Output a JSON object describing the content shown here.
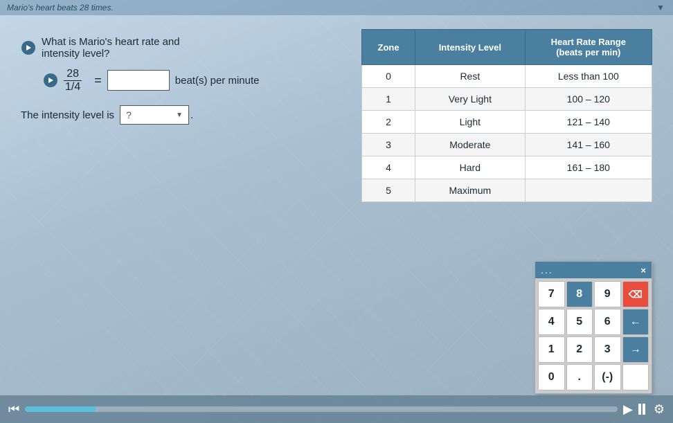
{
  "topBar": {
    "text": "Mario's heart beats 28 times.",
    "chevronLabel": "▲"
  },
  "question": {
    "audioIconLabel": "audio",
    "text1": "What is Mario's heart rate and",
    "text2": "intensity level?",
    "fraction": {
      "numerator": "28",
      "denominator": "1/4"
    },
    "equalsSign": "=",
    "answerPlaceholder": "",
    "bpmLabel": "beat(s) per minute"
  },
  "intensityRow": {
    "label": "The intensity level is",
    "dropdownValue": "?",
    "period": "."
  },
  "table": {
    "headers": [
      "Zone",
      "Intensity Level",
      "Heart Rate Range\n(beats per min)"
    ],
    "rows": [
      {
        "zone": "0",
        "intensity": "Rest",
        "range": "Less than 100"
      },
      {
        "zone": "1",
        "intensity": "Very Light",
        "range": "100 – 120"
      },
      {
        "zone": "2",
        "intensity": "Light",
        "range": "121 – 140"
      },
      {
        "zone": "3",
        "intensity": "Moderate",
        "range": "141 – 160"
      },
      {
        "zone": "4",
        "intensity": "Hard",
        "range": "161 – 180"
      },
      {
        "zone": "5",
        "intensity": "Maximum",
        "range": ""
      }
    ]
  },
  "keypad": {
    "dotsLabel": "...",
    "closeLabel": "×",
    "keys": [
      {
        "value": "7",
        "type": "normal"
      },
      {
        "value": "8",
        "type": "blue"
      },
      {
        "value": "9",
        "type": "normal"
      },
      {
        "value": "⌫",
        "type": "backspace"
      },
      {
        "value": "4",
        "type": "normal"
      },
      {
        "value": "5",
        "type": "normal"
      },
      {
        "value": "6",
        "type": "normal"
      },
      {
        "value": "←",
        "type": "blue"
      },
      {
        "value": "1",
        "type": "normal"
      },
      {
        "value": "2",
        "type": "normal"
      },
      {
        "value": "3",
        "type": "normal"
      },
      {
        "value": "→",
        "type": "blue"
      },
      {
        "value": "0",
        "type": "normal"
      },
      {
        "value": ".",
        "type": "normal"
      },
      {
        "value": "(-)",
        "type": "normal"
      },
      {
        "value": "",
        "type": "empty"
      }
    ]
  },
  "bottomBar": {
    "skipBackLabel": "⏮",
    "playLabel": "▶",
    "pauseLabel": "⏸",
    "settingsLabel": "⚙",
    "progressPercent": 12
  }
}
